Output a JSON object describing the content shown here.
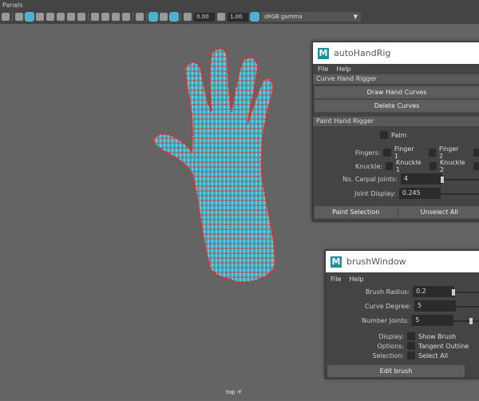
{
  "menu": {
    "panels": "Panels"
  },
  "toolbar": {
    "exposure": "0.00",
    "gamma": "1.00",
    "color_space": "sRGB gamma",
    "dropdown_arrow": "▼"
  },
  "viewport": {
    "camera_label": "top -Y"
  },
  "autoHandRig": {
    "title": "autoHandRig",
    "logo": "M",
    "menu": [
      "File",
      "Help"
    ],
    "curve_section": "Curve Hand Rigger",
    "draw_curves": "Draw Hand Curves",
    "delete_curves": "Delete Curves",
    "paint_section": "Paint Hand Rigger",
    "palm": "Palm",
    "fingers_label": "Fingers:",
    "finger1": "Finger 1",
    "finger2": "Finger 2",
    "knuckle_label": "Knuckle:",
    "knuckle1": "Knuckle 1",
    "knuckle2": "Knuckle 2",
    "carpal_label": "No. Carpal Joints:",
    "carpal_value": "4",
    "joint_display_label": "Joint Display:",
    "joint_display_value": "0.245",
    "paint_selection": "Paint Selection",
    "unselect_all": "Unselect All"
  },
  "brushWindow": {
    "title": "brushWindow",
    "logo": "M",
    "menu": [
      "File",
      "Help"
    ],
    "brush_radius_label": "Brush Radius:",
    "brush_radius": "0.2",
    "curve_degree_label": "Curve Degree:",
    "curve_degree": "5",
    "number_joints_label": "Number Joints:",
    "number_joints": "5",
    "display_label": "Display:",
    "show_brush": "Show Brush",
    "options_label": "Options:",
    "tangent_outline": "Tangent Outline",
    "selection_label": "Selection:",
    "select_all": "Select All",
    "edit_brush": "Edit brush"
  },
  "colors": {
    "mesh": "#4fd0e8",
    "joints": "#ff1a1a",
    "accent": "#4ab0d8"
  }
}
